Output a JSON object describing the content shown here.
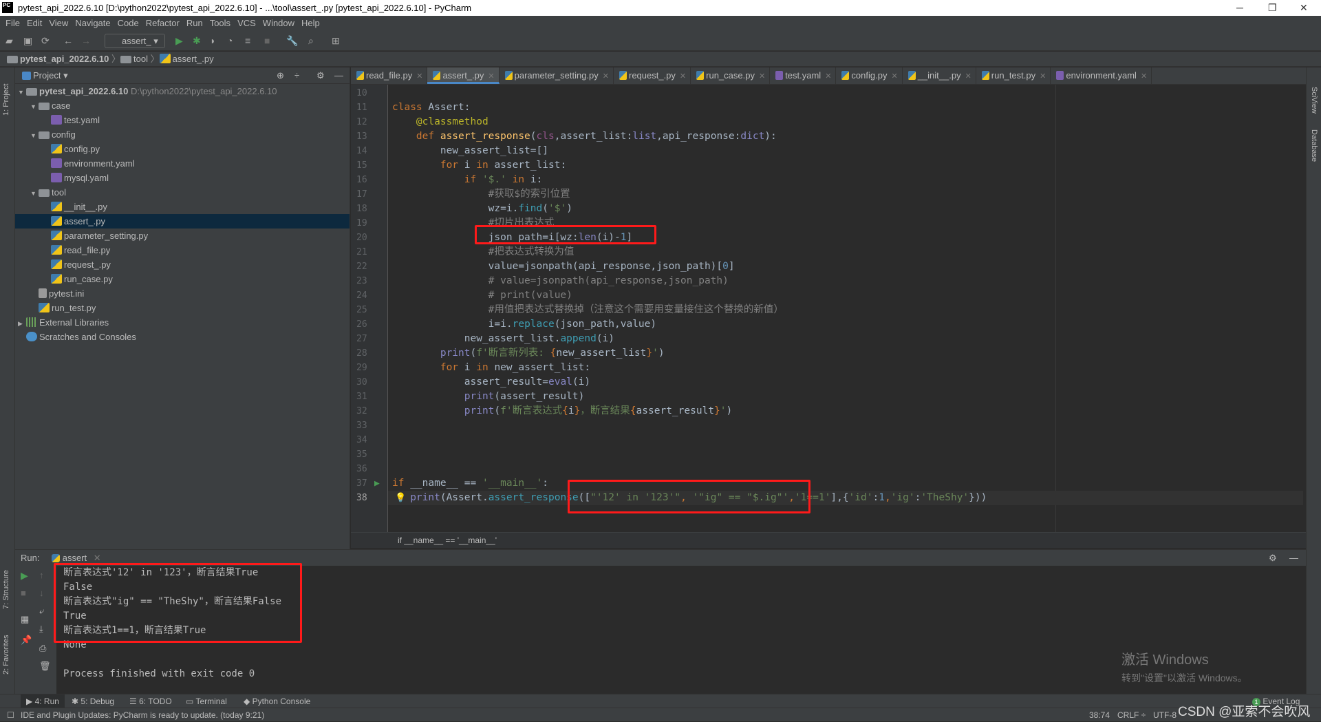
{
  "window": {
    "title": "pytest_api_2022.6.10 [D:\\python2022\\pytest_api_2022.6.10] - ...\\tool\\assert_.py [pytest_api_2022.6.10] - PyCharm",
    "logo": "PC",
    "minimize": "─",
    "restore": "❐",
    "close": "✕"
  },
  "menu": [
    "File",
    "Edit",
    "View",
    "Navigate",
    "Code",
    "Refactor",
    "Run",
    "Tools",
    "VCS",
    "Window",
    "Help"
  ],
  "toolbar": {
    "run_config": "assert_"
  },
  "breadcrumb": [
    "pytest_api_2022.6.10",
    "tool",
    "assert_.py"
  ],
  "leftstrip": {
    "project": "1: Project",
    "structure": "7: Structure",
    "favorites": "2: Favorites"
  },
  "rightstrip": {
    "sciview": "SciView",
    "database": "Database"
  },
  "project": {
    "title": "Project",
    "tree": [
      {
        "label": "pytest_api_2022.6.10",
        "hint": "D:\\python2022\\pytest_api_2022.6.10",
        "icon": "folder",
        "depth": 0,
        "arrow": "▼",
        "bold": true
      },
      {
        "label": "case",
        "icon": "folder",
        "depth": 1,
        "arrow": "▼"
      },
      {
        "label": "test.yaml",
        "icon": "yml",
        "depth": 2
      },
      {
        "label": "config",
        "icon": "folder",
        "depth": 1,
        "arrow": "▼"
      },
      {
        "label": "config.py",
        "icon": "py",
        "depth": 2
      },
      {
        "label": "environment.yaml",
        "icon": "yml",
        "depth": 2
      },
      {
        "label": "mysql.yaml",
        "icon": "yml",
        "depth": 2
      },
      {
        "label": "tool",
        "icon": "folder",
        "depth": 1,
        "arrow": "▼"
      },
      {
        "label": "__init__.py",
        "icon": "py",
        "depth": 2
      },
      {
        "label": "assert_.py",
        "icon": "py",
        "depth": 2,
        "selected": true
      },
      {
        "label": "parameter_setting.py",
        "icon": "py",
        "depth": 2
      },
      {
        "label": "read_file.py",
        "icon": "py",
        "depth": 2
      },
      {
        "label": "request_.py",
        "icon": "py",
        "depth": 2
      },
      {
        "label": "run_case.py",
        "icon": "py",
        "depth": 2
      },
      {
        "label": "pytest.ini",
        "icon": "ini",
        "depth": 1
      },
      {
        "label": "run_test.py",
        "icon": "py",
        "depth": 1
      },
      {
        "label": "External Libraries",
        "icon": "lib",
        "depth": 0,
        "arrow": "▶"
      },
      {
        "label": "Scratches and Consoles",
        "icon": "scr",
        "depth": 0
      }
    ]
  },
  "tabs": [
    {
      "label": "read_file.py",
      "icon": "py"
    },
    {
      "label": "assert_.py",
      "icon": "py",
      "active": true
    },
    {
      "label": "parameter_setting.py",
      "icon": "py"
    },
    {
      "label": "request_.py",
      "icon": "py"
    },
    {
      "label": "run_case.py",
      "icon": "py"
    },
    {
      "label": "test.yaml",
      "icon": "yml"
    },
    {
      "label": "config.py",
      "icon": "py"
    },
    {
      "label": "__init__.py",
      "icon": "py"
    },
    {
      "label": "run_test.py",
      "icon": "py"
    },
    {
      "label": "environment.yaml",
      "icon": "yml"
    }
  ],
  "editor": {
    "current_line": 38,
    "lines": [
      {
        "n": 10,
        "t": []
      },
      {
        "n": 11,
        "t": [
          [
            "class ",
            "kw"
          ],
          [
            "Assert:",
            "plain"
          ]
        ]
      },
      {
        "n": 12,
        "t": [
          [
            "    @classmethod",
            "dec"
          ]
        ]
      },
      {
        "n": 13,
        "t": [
          [
            "    def ",
            "kw"
          ],
          [
            "assert_response",
            "fn"
          ],
          [
            "(",
            "plain"
          ],
          [
            "cls",
            "slf"
          ],
          [
            ",assert_list:",
            "plain"
          ],
          [
            "list",
            "bi"
          ],
          [
            ",api_response:",
            "plain"
          ],
          [
            "dict",
            "bi"
          ],
          [
            "):",
            "plain"
          ]
        ]
      },
      {
        "n": 14,
        "t": [
          [
            "        new_assert_list=[]",
            "plain"
          ]
        ]
      },
      {
        "n": 15,
        "t": [
          [
            "        for ",
            "kw"
          ],
          [
            "i ",
            "plain"
          ],
          [
            "in ",
            "kw"
          ],
          [
            "assert_list:",
            "plain"
          ]
        ]
      },
      {
        "n": 16,
        "t": [
          [
            "            if ",
            "kw"
          ],
          [
            "'$.' ",
            "str"
          ],
          [
            "in ",
            "kw"
          ],
          [
            "i:",
            "plain"
          ]
        ]
      },
      {
        "n": 17,
        "t": [
          [
            "                #获取$的索引位置",
            "cm"
          ]
        ]
      },
      {
        "n": 18,
        "t": [
          [
            "                wz=i.",
            "plain"
          ],
          [
            "find",
            "mt"
          ],
          [
            "(",
            "plain"
          ],
          [
            "'$'",
            "str"
          ],
          [
            ")",
            "plain"
          ]
        ]
      },
      {
        "n": 19,
        "t": [
          [
            "                #切片出表达式",
            "cm"
          ]
        ]
      },
      {
        "n": 20,
        "t": [
          [
            "                json_path=i[wz:",
            "plain"
          ],
          [
            "len",
            "bi"
          ],
          [
            "(i)-",
            "plain"
          ],
          [
            "1",
            "num"
          ],
          [
            "]",
            "plain"
          ]
        ]
      },
      {
        "n": 21,
        "t": [
          [
            "                #把表达式转换为值",
            "cm"
          ]
        ]
      },
      {
        "n": 22,
        "t": [
          [
            "                value=jsonpath(api_response,json_path)[",
            "plain"
          ],
          [
            "0",
            "num"
          ],
          [
            "]",
            "plain"
          ]
        ]
      },
      {
        "n": 23,
        "t": [
          [
            "                # value=jsonpath(api_response,json_path)",
            "cm"
          ]
        ]
      },
      {
        "n": 24,
        "t": [
          [
            "                # print(value)",
            "cm"
          ]
        ]
      },
      {
        "n": 25,
        "t": [
          [
            "                #用值把表达式替换掉（注意这个需要用变量接住这个替换的新值）",
            "cm"
          ]
        ]
      },
      {
        "n": 26,
        "t": [
          [
            "                i=i.",
            "plain"
          ],
          [
            "replace",
            "mt"
          ],
          [
            "(json_path,value)",
            "plain"
          ]
        ]
      },
      {
        "n": 27,
        "t": [
          [
            "            new_assert_list.",
            "plain"
          ],
          [
            "append",
            "mt"
          ],
          [
            "(i)",
            "plain"
          ]
        ]
      },
      {
        "n": 28,
        "t": [
          [
            "        print",
            "bi"
          ],
          [
            "(",
            "plain"
          ],
          [
            "f'断言新列表: ",
            "str"
          ],
          [
            "{",
            "kw"
          ],
          [
            "new_assert_list",
            "plain"
          ],
          [
            "}",
            "kw"
          ],
          [
            "'",
            "str"
          ],
          [
            ")",
            "plain"
          ]
        ]
      },
      {
        "n": 29,
        "t": [
          [
            "        for ",
            "kw"
          ],
          [
            "i ",
            "plain"
          ],
          [
            "in ",
            "kw"
          ],
          [
            "new_assert_list:",
            "plain"
          ]
        ]
      },
      {
        "n": 30,
        "t": [
          [
            "            assert_result=",
            "plain"
          ],
          [
            "eval",
            "bi"
          ],
          [
            "(i)",
            "plain"
          ]
        ]
      },
      {
        "n": 31,
        "t": [
          [
            "            print",
            "bi"
          ],
          [
            "(assert_result)",
            "plain"
          ]
        ]
      },
      {
        "n": 32,
        "t": [
          [
            "            print",
            "bi"
          ],
          [
            "(",
            "plain"
          ],
          [
            "f'断言表达式",
            "str"
          ],
          [
            "{",
            "kw"
          ],
          [
            "i",
            "plain"
          ],
          [
            "}",
            "kw"
          ],
          [
            "，断言结果",
            "str"
          ],
          [
            "{",
            "kw"
          ],
          [
            "assert_result",
            "plain"
          ],
          [
            "}",
            "kw"
          ],
          [
            "'",
            "str"
          ],
          [
            ")",
            "plain"
          ]
        ]
      },
      {
        "n": 33,
        "t": []
      },
      {
        "n": 34,
        "t": []
      },
      {
        "n": 35,
        "t": []
      },
      {
        "n": 36,
        "t": []
      },
      {
        "n": 37,
        "t": [
          [
            "if ",
            "kw"
          ],
          [
            "__name__ == ",
            "plain"
          ],
          [
            "'__main__'",
            "str"
          ],
          [
            ":",
            "plain"
          ]
        ]
      },
      {
        "n": 38,
        "t": [
          [
            "   print",
            "bi"
          ],
          [
            "(Assert.",
            "plain"
          ],
          [
            "assert_response",
            "mt"
          ],
          [
            "([",
            "plain"
          ],
          [
            "\"'12' in '123'\"",
            "str"
          ],
          [
            ", ",
            "kw"
          ],
          [
            "'\"ig\" == \"$.ig\"'",
            "str"
          ],
          [
            ",",
            "kw"
          ],
          [
            "'1==1'",
            "str"
          ],
          [
            "],",
            "plain"
          ],
          [
            "{",
            "plain"
          ],
          [
            "'id'",
            "str"
          ],
          [
            ":",
            "plain"
          ],
          [
            "1",
            "num"
          ],
          [
            ",",
            "kw"
          ],
          [
            "'ig'",
            "str"
          ],
          [
            ":",
            "plain"
          ],
          [
            "'TheShy'",
            "str"
          ],
          [
            "}))",
            "plain"
          ]
        ]
      }
    ],
    "breadcrumb": "if __name__ == '__main__'"
  },
  "run": {
    "label": "Run:",
    "tab": "assert",
    "output": [
      "断言表达式'12' in '123'，断言结果True",
      "False",
      "断言表达式\"ig\" == \"TheShy\"，断言结果False",
      "True",
      "断言表达式1==1，断言结果True",
      "None",
      "",
      "Process finished with exit code 0"
    ]
  },
  "bottom_tabs": [
    "4: Run",
    "5: Debug",
    "6: TODO",
    "Terminal",
    "Python Console"
  ],
  "event_log": {
    "count": "1",
    "label": "Event Log"
  },
  "status": {
    "message": "IDE and Plugin Updates: PyCharm is ready to update. (today 9:21)",
    "position": "38:74",
    "line_sep": "CRLF ÷",
    "encoding": "UTF-8"
  },
  "watermark": {
    "activate_title": "激活 Windows",
    "activate_sub": "转到\"设置\"以激活 Windows。",
    "csdn": "CSDN @亚索不会吹风"
  },
  "colors": {
    "highlight_box": "#ff1a1a",
    "selection": "#0d293e",
    "tab_underline": "#4a88c7"
  }
}
